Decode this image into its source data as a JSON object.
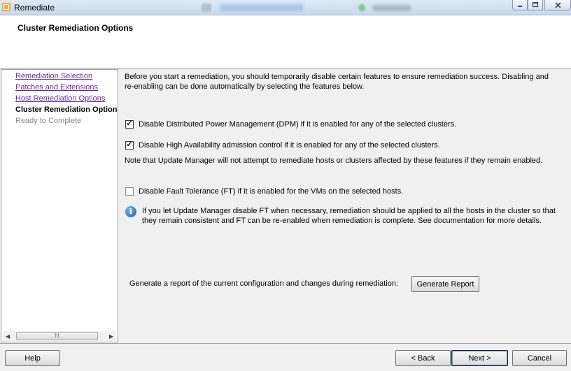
{
  "window": {
    "title": "Remediate",
    "controls": [
      "minimize",
      "maximize",
      "close"
    ]
  },
  "header": {
    "title": "Cluster Remediation Options"
  },
  "nav": {
    "items": [
      {
        "label": "Remediation Selection",
        "state": "link"
      },
      {
        "label": "Patches and Extensions",
        "state": "link"
      },
      {
        "label": "Host Remediation Options",
        "state": "link"
      },
      {
        "label": "Cluster Remediation Options",
        "state": "current"
      },
      {
        "label": "Ready to Complete",
        "state": "future"
      }
    ]
  },
  "main": {
    "intro_line1": "Before you start a remediation, you should temporarily disable certain features to ensure remediation success. Disabling and",
    "intro_line2": "re-enabling can be done automatically by selecting the features below.",
    "options": [
      {
        "label": "Disable Distributed Power Management (DPM) if it is enabled for any of the selected clusters.",
        "checked": true
      },
      {
        "label": "Disable High Availability admission control if it is enabled for any of the selected clusters.",
        "checked": true
      },
      {
        "label": "Disable Fault Tolerance (FT) if it is enabled for the VMs on the selected hosts.",
        "checked": false
      }
    ],
    "note": "Note that Update Manager will not attempt to remediate hosts or clusters affected by these features if they remain enabled.",
    "info_line1": "If you let Update Manager disable FT when necessary, remediation should be applied to all the hosts in the cluster so that",
    "info_line2": "they remain consistent and FT can be re-enabled when remediation is complete. See documentation for more details.",
    "report_label": "Generate a report of the current configuration and changes during remediation:",
    "generate_button": "Generate Report"
  },
  "footer": {
    "help": "Help",
    "back": "< Back",
    "next": "Next >",
    "cancel": "Cancel"
  },
  "icons": {
    "app": "vsphere-icon",
    "info": "info-icon",
    "scroll_thumb": "III"
  }
}
